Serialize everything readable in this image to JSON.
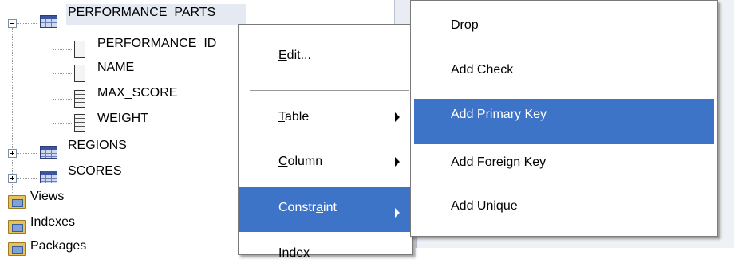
{
  "tree": {
    "nodes": [
      {
        "label": "PERFORMANCE_PARTS",
        "icon": "table-icon"
      },
      {
        "label": "PERFORMANCE_ID",
        "icon": "column-icon"
      },
      {
        "label": "NAME",
        "icon": "column-icon"
      },
      {
        "label": "MAX_SCORE",
        "icon": "column-icon"
      },
      {
        "label": "WEIGHT",
        "icon": "column-icon"
      },
      {
        "label": "REGIONS",
        "icon": "table-icon"
      },
      {
        "label": "SCORES",
        "icon": "table-icon"
      },
      {
        "label": "Views",
        "icon": "folder-icon"
      },
      {
        "label": "Indexes",
        "icon": "folder-icon"
      },
      {
        "label": "Packages",
        "icon": "folder-icon"
      }
    ]
  },
  "context_menu": {
    "items": [
      {
        "label": "Edit...",
        "mnemonic": "E",
        "has_submenu": false
      },
      {
        "label": "Table",
        "mnemonic": "T",
        "has_submenu": true
      },
      {
        "label": "Column",
        "mnemonic": "C",
        "has_submenu": true
      },
      {
        "label": "Constraint",
        "mnemonic": "a",
        "has_submenu": true,
        "highlighted": true
      },
      {
        "label": "Index",
        "has_submenu": true
      }
    ]
  },
  "submenu": {
    "items": [
      {
        "label": "Drop"
      },
      {
        "label": "Add Check"
      },
      {
        "label": "Add Primary Key",
        "highlighted": true
      },
      {
        "label": "Add Foreign Key"
      },
      {
        "label": "Add Unique"
      }
    ]
  },
  "colors": {
    "highlight": "#3d74c8",
    "selection": "#e4e9f2"
  }
}
